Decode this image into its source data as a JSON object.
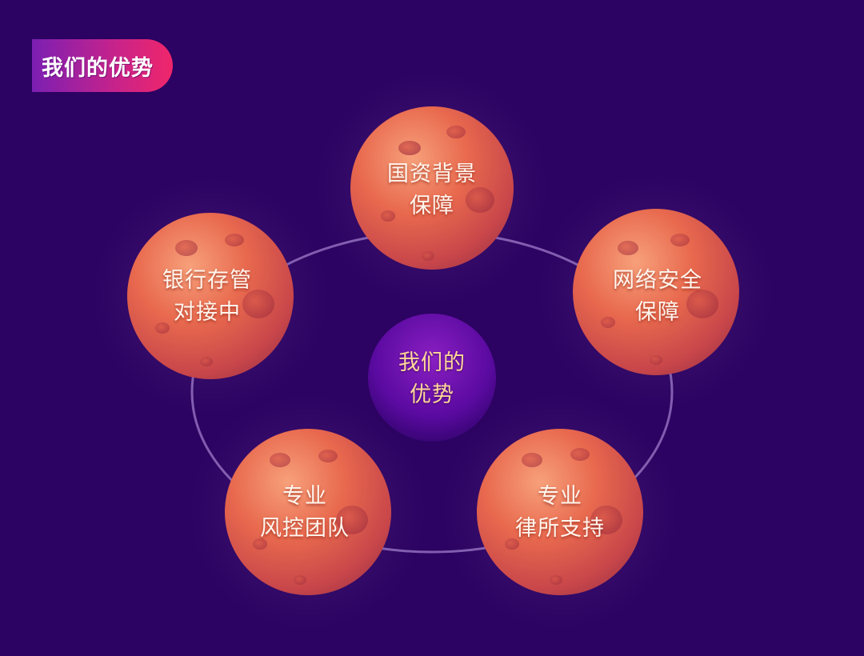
{
  "header": {
    "badge_label": "我们的优势"
  },
  "center": {
    "line1": "我们的",
    "line2": "优势"
  },
  "advantages": [
    {
      "line1": "国资背景",
      "line2": "保障"
    },
    {
      "line1": "网络安全",
      "line2": "保障"
    },
    {
      "line1": "专业",
      "line2": "律所支持"
    },
    {
      "line1": "专业",
      "line2": "风控团队"
    },
    {
      "line1": "银行存管",
      "line2": "对接中"
    }
  ],
  "colors": {
    "background": "#2c0262",
    "planet": "#e86a4e",
    "badge_start": "#7b1fb3",
    "badge_end": "#f0266a",
    "center_label": "#ffd79a"
  }
}
